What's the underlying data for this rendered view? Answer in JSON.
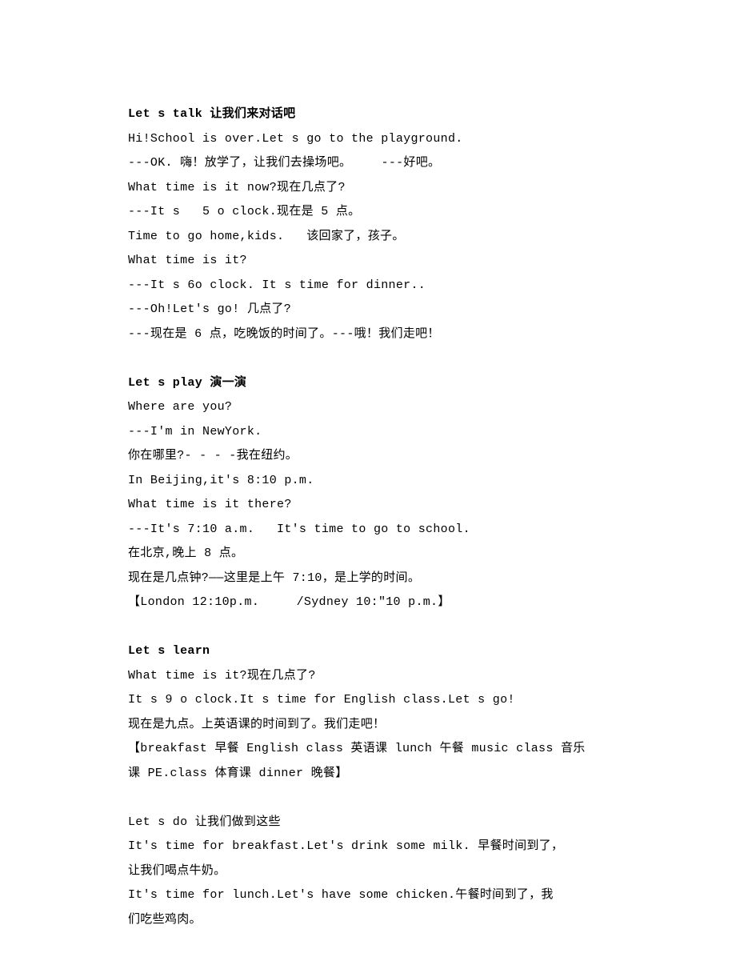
{
  "sections": [
    {
      "type": "heading",
      "text": "Let s talk 让我们来对话吧"
    },
    {
      "type": "line",
      "text": "Hi!School is over.Let s go to the playground."
    },
    {
      "type": "line",
      "text": "---OK. 嗨！放学了，让我们去操场吧。    ---好吧。"
    },
    {
      "type": "line",
      "text": "What time is it now?现在几点了?"
    },
    {
      "type": "line",
      "text": "---It s   5 o clock.现在是 5 点。"
    },
    {
      "type": "line",
      "text": "Time to go home,kids.   该回家了，孩子。"
    },
    {
      "type": "line",
      "text": "What time is it?"
    },
    {
      "type": "line",
      "text": "---It s 6o clock. It s time for dinner.."
    },
    {
      "type": "line",
      "text": "---Oh!Let's go! 几点了?"
    },
    {
      "type": "line",
      "text": "---现在是 6 点，吃晚饭的时间了。---哦！我们走吧！"
    },
    {
      "type": "blank"
    },
    {
      "type": "heading",
      "text": "Let s play 演一演"
    },
    {
      "type": "line",
      "text": "Where are you?"
    },
    {
      "type": "line",
      "text": "---I'm in NewYork."
    },
    {
      "type": "line",
      "text": "你在哪里?- - - -我在纽约。"
    },
    {
      "type": "line",
      "text": "In Beijing,it's 8:10 p.m."
    },
    {
      "type": "line",
      "text": "What time is it there?"
    },
    {
      "type": "line",
      "text": "---It's 7:10 a.m.   It's time to go to school."
    },
    {
      "type": "line",
      "text": "在北京,晚上 8 点。"
    },
    {
      "type": "line",
      "text": "现在是几点钟?——这里是上午 7:10，是上学的时间。"
    },
    {
      "type": "line",
      "text": "【London 12:10p.m.     /Sydney 10:\"10 p.m.】"
    },
    {
      "type": "blank"
    },
    {
      "type": "heading",
      "text": "Let s learn"
    },
    {
      "type": "line",
      "text": "What time is it?现在几点了?"
    },
    {
      "type": "line",
      "text": "It s 9 o clock.It s time for English class.Let s go!"
    },
    {
      "type": "line",
      "text": "现在是九点。上英语课的时间到了。我们走吧！"
    },
    {
      "type": "line",
      "text": "【breakfast 早餐 English class 英语课 lunch 午餐 music class 音乐"
    },
    {
      "type": "line",
      "text": "课 PE.class 体育课 dinner 晚餐】"
    },
    {
      "type": "blank"
    },
    {
      "type": "line",
      "text": "Let s do 让我们做到这些"
    },
    {
      "type": "line",
      "text": "It's time for breakfast.Let's drink some milk. 早餐时间到了，"
    },
    {
      "type": "line",
      "text": "让我们喝点牛奶。"
    },
    {
      "type": "line",
      "text": "It's time for lunch.Let's have some chicken.午餐时间到了，我"
    },
    {
      "type": "line",
      "text": "们吃些鸡肉。"
    }
  ]
}
